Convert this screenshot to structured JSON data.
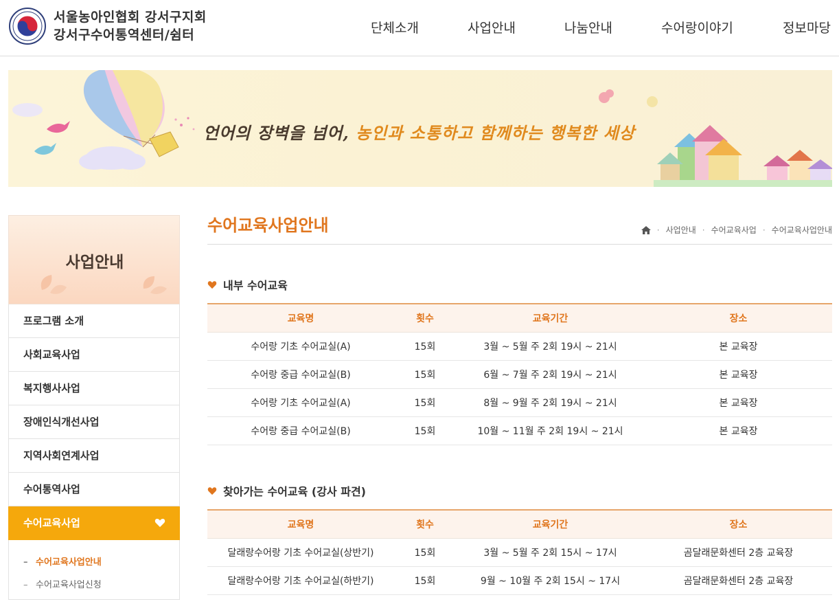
{
  "header": {
    "org_name_line1": "서울농아인협회 강서구지회",
    "org_name_line2": "강서구수어통역센터/쉼터",
    "nav": [
      "단체소개",
      "사업안내",
      "나눔안내",
      "수어랑이야기",
      "정보마당"
    ]
  },
  "banner": {
    "slogan_part1": "언어의 장벽을 넘어,",
    "slogan_part2": "농인과 소통하고 함께하는 행복한 세상"
  },
  "sidebar": {
    "title": "사업안내",
    "items": [
      "프로그램 소개",
      "사회교육사업",
      "복지행사사업",
      "장애인식개선사업",
      "지역사회연계사업",
      "수어통역사업",
      "수어교육사업"
    ],
    "subitems": [
      "수어교육사업안내",
      "수어교육사업신청"
    ]
  },
  "content": {
    "page_title": "수어교육사업안내",
    "breadcrumb": [
      "사업안내",
      "수어교육사업",
      "수어교육사업안내"
    ],
    "section1": {
      "title": "내부 수어교육",
      "headers": [
        "교육명",
        "횟수",
        "교육기간",
        "장소"
      ],
      "rows": [
        [
          "수어랑 기초 수어교실(A)",
          "15회",
          "3월 ~ 5월 주 2회 19시 ~ 21시",
          "본 교육장"
        ],
        [
          "수어랑 중급 수어교실(B)",
          "15회",
          "6월 ~ 7월 주 2회 19시 ~ 21시",
          "본 교육장"
        ],
        [
          "수어랑 기초 수어교실(A)",
          "15회",
          "8월 ~ 9월 주 2회 19시 ~ 21시",
          "본 교육장"
        ],
        [
          "수어랑 중급 수어교실(B)",
          "15회",
          "10월 ~ 11월 주 2회 19시 ~ 21시",
          "본 교육장"
        ]
      ]
    },
    "section2": {
      "title": "찾아가는 수어교육 (강사 파견)",
      "headers": [
        "교육명",
        "횟수",
        "교육기간",
        "장소"
      ],
      "rows": [
        [
          "달래랑수어랑 기초 수어교실(상반기)",
          "15회",
          "3월 ~ 5월 주 2회 15시 ~ 17시",
          "곰달래문화센터 2층 교육장"
        ],
        [
          "달래랑수어랑 기초 수어교실(하반기)",
          "15회",
          "9월 ~ 10월 주 2회 15시 ~ 17시",
          "곰달래문화센터 2층 교육장"
        ]
      ]
    }
  },
  "colors": {
    "accent": "#e0761e",
    "active_menu": "#f5a80c",
    "table_header_bg": "#fdf3ec"
  }
}
